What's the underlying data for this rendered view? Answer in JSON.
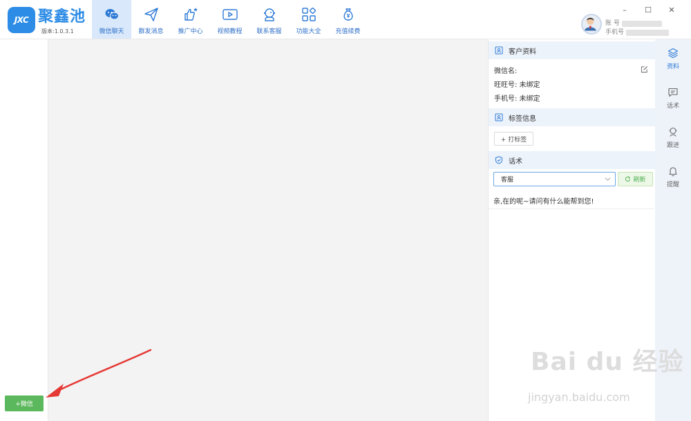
{
  "app": {
    "logo_text": "JXC",
    "name": "聚鑫池",
    "version": "版本:1.0.3.1"
  },
  "nav": [
    {
      "label": "微信聊天",
      "icon": "wechat-icon",
      "active": true
    },
    {
      "label": "群发消息",
      "icon": "send-icon"
    },
    {
      "label": "推广中心",
      "icon": "thumbs-up-icon"
    },
    {
      "label": "视频教程",
      "icon": "video-icon"
    },
    {
      "label": "联系客服",
      "icon": "support-icon"
    },
    {
      "label": "功能大全",
      "icon": "apps-icon"
    },
    {
      "label": "充值续费",
      "icon": "money-bag-icon"
    }
  ],
  "account": {
    "account_label": "账  号",
    "phone_label": "手机号"
  },
  "window": {
    "minimize": "–",
    "maximize": "☐",
    "close": "✕"
  },
  "left": {
    "add_wechat_label": "+微信"
  },
  "customer": {
    "section_title": "客户资料",
    "wechat_name_label": "微信名:",
    "wangwang_label": "旺旺号: 未绑定",
    "phone_label": "手机号: 未绑定"
  },
  "tags": {
    "section_title": "标签信息",
    "add_tag_label": "+ 打标签"
  },
  "scripts": {
    "section_title": "话术",
    "selected": "客服",
    "refresh_label": "刷新",
    "items": [
      "亲,在的呢~请问有什么能帮到您!"
    ]
  },
  "side_strip": [
    {
      "label": "资料",
      "icon": "layers-icon",
      "active": true
    },
    {
      "label": "话术",
      "icon": "message-icon"
    },
    {
      "label": "跟进",
      "icon": "follow-up-icon"
    },
    {
      "label": "提醒",
      "icon": "bell-icon"
    }
  ],
  "watermark": {
    "brand": "Bai du 经验",
    "url": "jingyan.baidu.com"
  },
  "colors": {
    "accent": "#2d8ce6",
    "green": "#5cb85c",
    "arrow": "#e53935"
  }
}
